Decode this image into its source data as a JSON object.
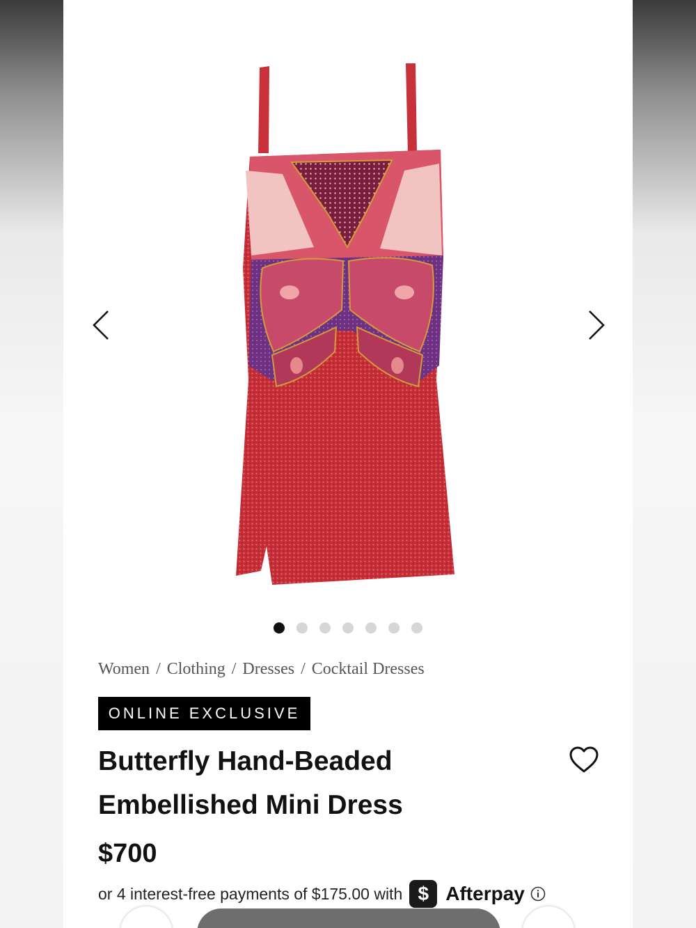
{
  "carousel": {
    "prev_icon": "chevron-left-icon",
    "next_icon": "chevron-right-icon",
    "slide_count": 7,
    "active_slide": 1
  },
  "breadcrumb": {
    "items": [
      "Women",
      "Clothing",
      "Dresses",
      "Cocktail Dresses"
    ],
    "separator": "/"
  },
  "badge": {
    "label": "ONLINE EXCLUSIVE"
  },
  "product": {
    "title_line1": "Butterfly Hand-Beaded",
    "title_line2": "Embellished Mini Dress",
    "price": "$700",
    "wishlist_icon": "heart-outline-icon"
  },
  "payments": {
    "text": "or 4 interest-free payments of $175.00 with",
    "provider_logo_glyph": "$",
    "provider_name": "Afterpay",
    "info_icon": "info-icon"
  },
  "colors": {
    "dress_red": "#c8303a",
    "dress_purple": "#6a2f7a",
    "badge_bg": "#000000",
    "dot_active": "#111111",
    "dot_inactive": "#d6d6d6"
  }
}
